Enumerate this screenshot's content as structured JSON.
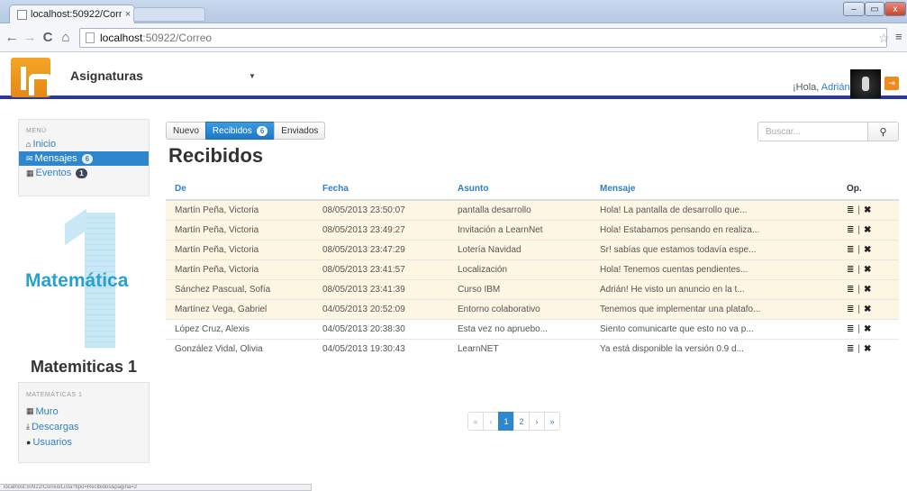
{
  "browser": {
    "tab_title": "localhost:50922/Correo",
    "tab_close": "×",
    "url_host": "localhost",
    "url_path": ":50922/Correo",
    "status_url": "localhost:50922/Correo/Lista?tipo=Recibidos&pagina=2"
  },
  "header": {
    "course_selector": "Asignaturas",
    "caret": "▼",
    "greeting_prefix": "¡Hola, ",
    "greeting_name": "Adrián!",
    "accent_color": "#2a3a95",
    "logo_color": "#f5a623"
  },
  "sidebar": {
    "menu_header": "MENÚ",
    "items": [
      {
        "label": "Inicio",
        "icon": "home-icon"
      },
      {
        "label": "Mensajes",
        "icon": "envelope-icon",
        "badge": "6"
      },
      {
        "label": "Eventos",
        "icon": "calendar-icon",
        "badge": "1"
      }
    ],
    "subject_word": "Matemática",
    "course_title": "Matemiticas 1",
    "course_menu_header": "MATEMÁTICAS 1",
    "course_items": [
      {
        "label": "Muro",
        "icon": "grid-icon"
      },
      {
        "label": "Descargas",
        "icon": "download-icon"
      },
      {
        "label": "Usuarios",
        "icon": "user-icon"
      }
    ]
  },
  "main": {
    "buttons": [
      {
        "label": "Nuevo"
      },
      {
        "label": "Recibidos",
        "badge": "6"
      },
      {
        "label": "Enviados"
      }
    ],
    "search_placeholder": "Buscar...",
    "title": "Recibidos",
    "columns": [
      "De",
      "Fecha",
      "Asunto",
      "Mensaje",
      "Op."
    ],
    "rows": [
      {
        "de": "Martín Peña, Victoria",
        "fecha": "08/05/2013 23:50:07",
        "asunto": "pantalla desarrollo",
        "mensaje": "Hola! La pantalla de desarrollo que...",
        "unread": true
      },
      {
        "de": "Martín Peña, Victoria",
        "fecha": "08/05/2013 23:49:27",
        "asunto": "Invitación a LearnNet",
        "mensaje": "Hola! Estabamos pensando en realiza...",
        "unread": true
      },
      {
        "de": "Martín Peña, Victoria",
        "fecha": "08/05/2013 23:47:29",
        "asunto": "Lotería Navidad",
        "mensaje": "Sr! sabías que estamos todavía espe...",
        "unread": true
      },
      {
        "de": "Martín Peña, Victoria",
        "fecha": "08/05/2013 23:41:57",
        "asunto": "Localización",
        "mensaje": "Hola! Tenemos cuentas pendientes...",
        "unread": true
      },
      {
        "de": "Sánchez Pascual, Sofía",
        "fecha": "08/05/2013 23:41:39",
        "asunto": "Curso IBM",
        "mensaje": "Adrián! He visto un anuncio en la t...",
        "unread": true
      },
      {
        "de": "Martínez Vega, Gabriel",
        "fecha": "04/05/2013 20:52:09",
        "asunto": "Entorno colaborativo",
        "mensaje": "Tenemos que implementar una platafo...",
        "unread": true
      },
      {
        "de": "López Cruz, Alexis",
        "fecha": "04/05/2013 20:38:30",
        "asunto": "Esta vez no apruebo...",
        "mensaje": "Siento comunicarte que esto no va p...",
        "unread": false
      },
      {
        "de": "González Vidal, Olivia",
        "fecha": "04/05/2013 19:30:43",
        "asunto": "LearnNET",
        "mensaje": "Ya está disponible la versión 0.9 d...",
        "unread": false
      }
    ],
    "op_list": "≣",
    "op_sep": "|",
    "op_delete": "✖",
    "pagination": [
      "«",
      "‹",
      "1",
      "2",
      "›",
      "»"
    ],
    "current_page": "1"
  }
}
